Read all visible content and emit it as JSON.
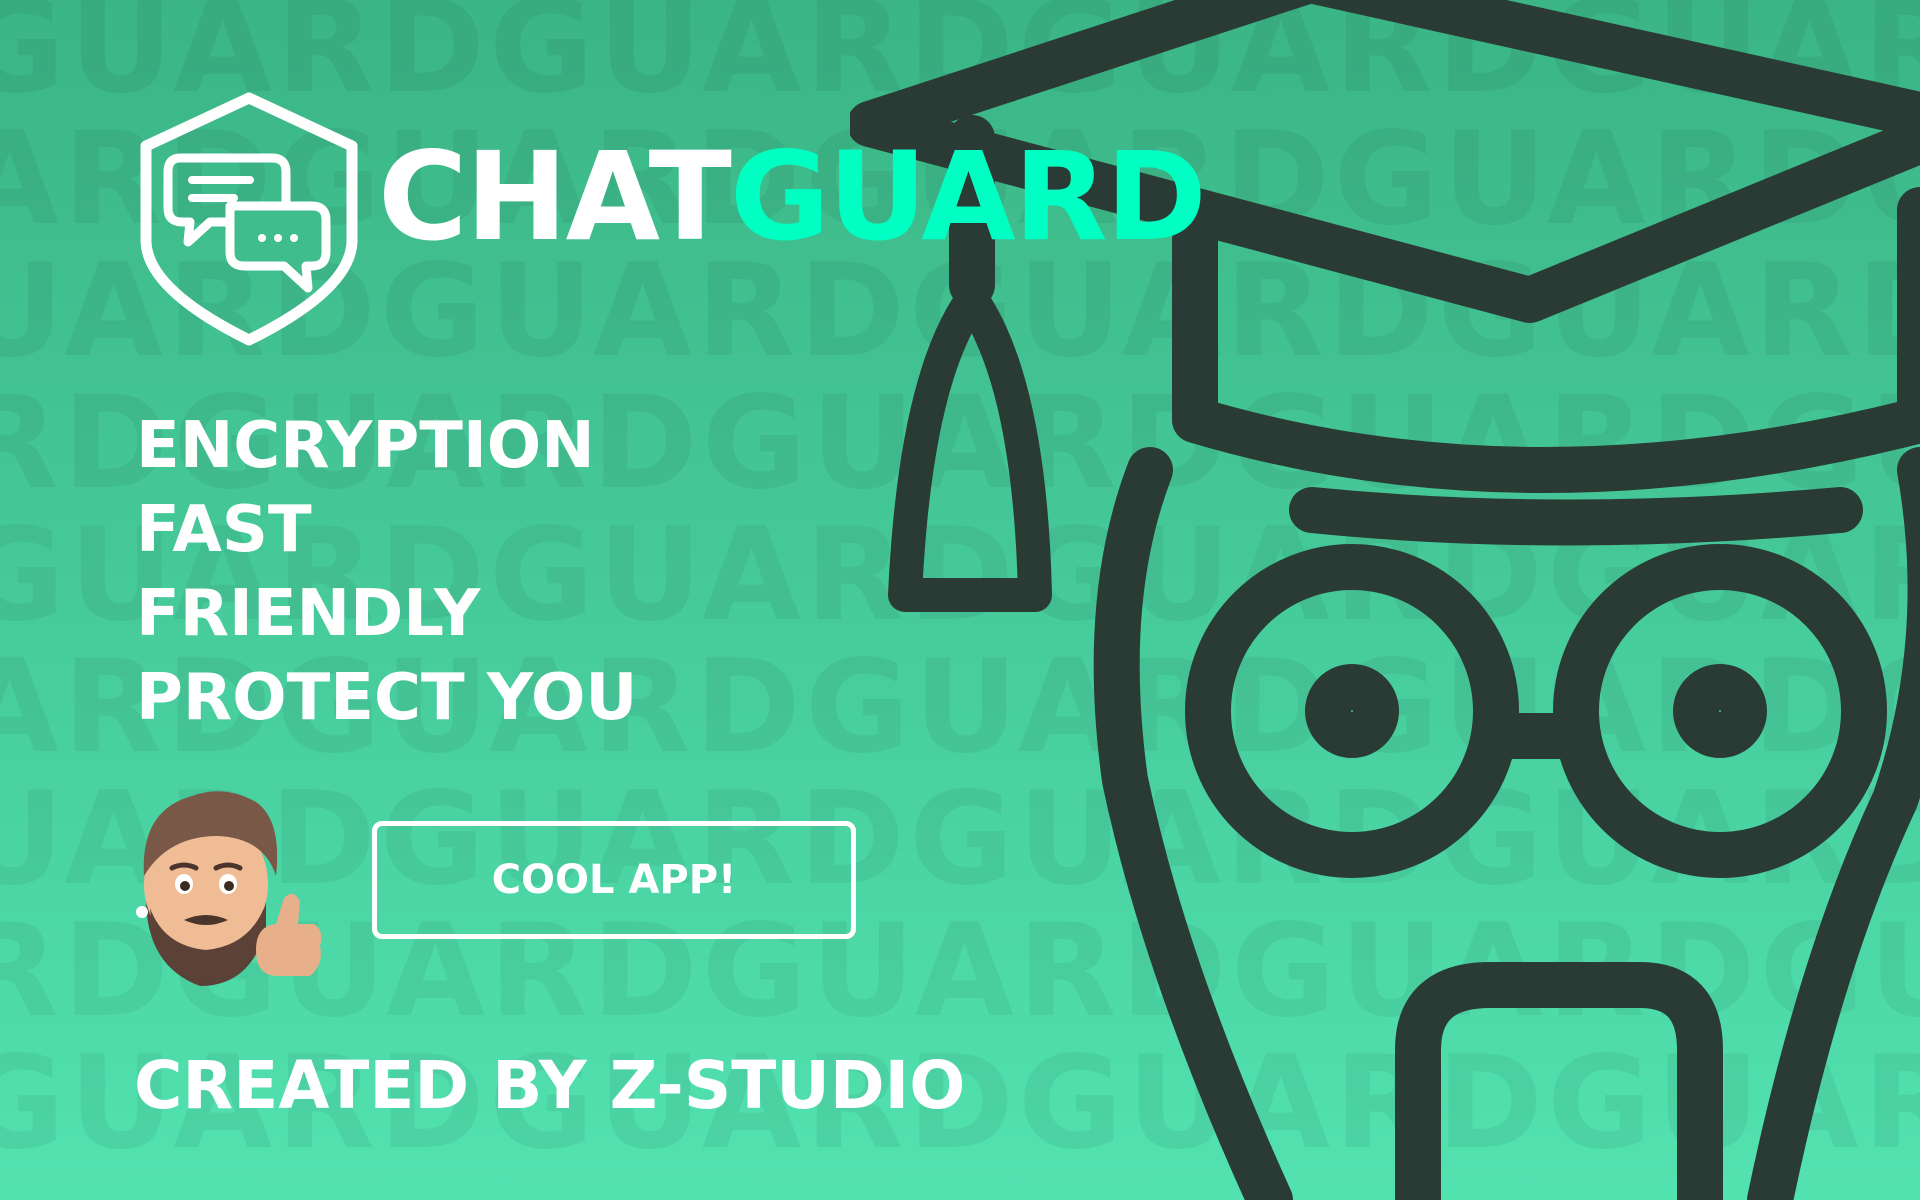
{
  "brand": {
    "chat": "CHAT",
    "guard": "GUARD"
  },
  "background_pattern": [
    "GUARDGUARDGUARDGUARDGUARD",
    "ARDGUARDGUARDGUARDGUARDGUARD",
    "UARDGUARDGUARDGUARDGUARDG",
    "RDGUARDGUARDGUARDGUARDGUARD",
    "GUARDGUARDGUARDGUARDGUARD",
    "ARDGUARDGUARDGUARDGUARDGUARD",
    "UARDGUARDGUARDGUARDGUARDG",
    "RDGUARDGUARDGUARDGUARDGUARD",
    "GUARDGUARDGUARDGUARDGUARD"
  ],
  "features": [
    "ENCRYPTION",
    "FAST",
    "FRIENDLY",
    "PROTECT YOU"
  ],
  "cta": {
    "label": "COOL APP!"
  },
  "credit": "CREATED BY Z-STUDIO",
  "icons": {
    "logo": "shield-chat-icon",
    "mascot": "graduate-owl-illustration",
    "avatar": "bearded-man-thumbs-up-memoji"
  },
  "colors": {
    "background_top": "#3bb585",
    "background_bottom": "#52e2b0",
    "accent": "#00ffc2",
    "text": "#ffffff",
    "outline": "#2a3a35"
  }
}
